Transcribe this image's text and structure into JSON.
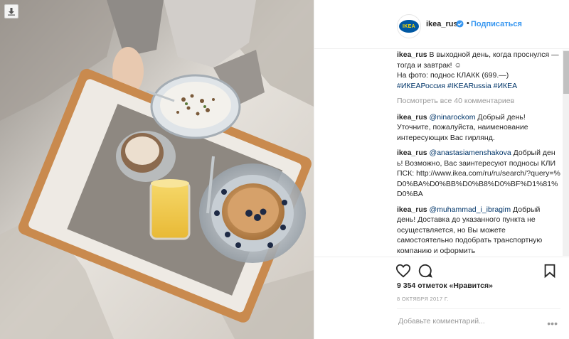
{
  "post": {
    "username": "ikea_rus",
    "follow_label": "Подписаться",
    "logo_text": "IKEA",
    "dot": "•"
  },
  "caption": {
    "username": "ikea_rus",
    "line1": "В выходной день, когда проснулся — тогда и завтрак! ☺",
    "line2": "На фото: поднос КЛАКК (699.—)",
    "hashtags": "#ИКЕАРоссия #IKEARussia #ИКЕА"
  },
  "view_all_comments": "Посмотреть все 40 комментариев",
  "comments": [
    {
      "user": "ikea_rus",
      "mention": "@ninarockom",
      "text": "Добрый день! Уточните, пожалуйста, наименование интересующих Вас гирлянд."
    },
    {
      "user": "ikea_rus",
      "mention": "@anastasiamenshakova",
      "text": "Добрый день! Возможно, Вас заинтересуют подносы КЛИПСК: http://www.ikea.com/ru/ru/search/?query=%D0%BA%D0%BB%D0%B8%D0%BF%D1%81%D0%BA"
    },
    {
      "user": "ikea_rus",
      "mention": "@muhammad_i_ibragim",
      "text": "Добрый день! Доставка до указанного пункта не осуществляется, но Вы можете самостоятельно подобрать транспортную компанию и оформить"
    }
  ],
  "likes": "9 354 отметок «Нравится»",
  "date": "8 ОКТЯБРЯ 2017 Г.",
  "comment_placeholder": "Добавьте комментарий...",
  "more_dots": "•••",
  "icons": {
    "download": "download-icon",
    "verified": "verified-badge-icon",
    "like": "heart-icon",
    "comment": "comment-bubble-icon",
    "save": "bookmark-icon"
  }
}
